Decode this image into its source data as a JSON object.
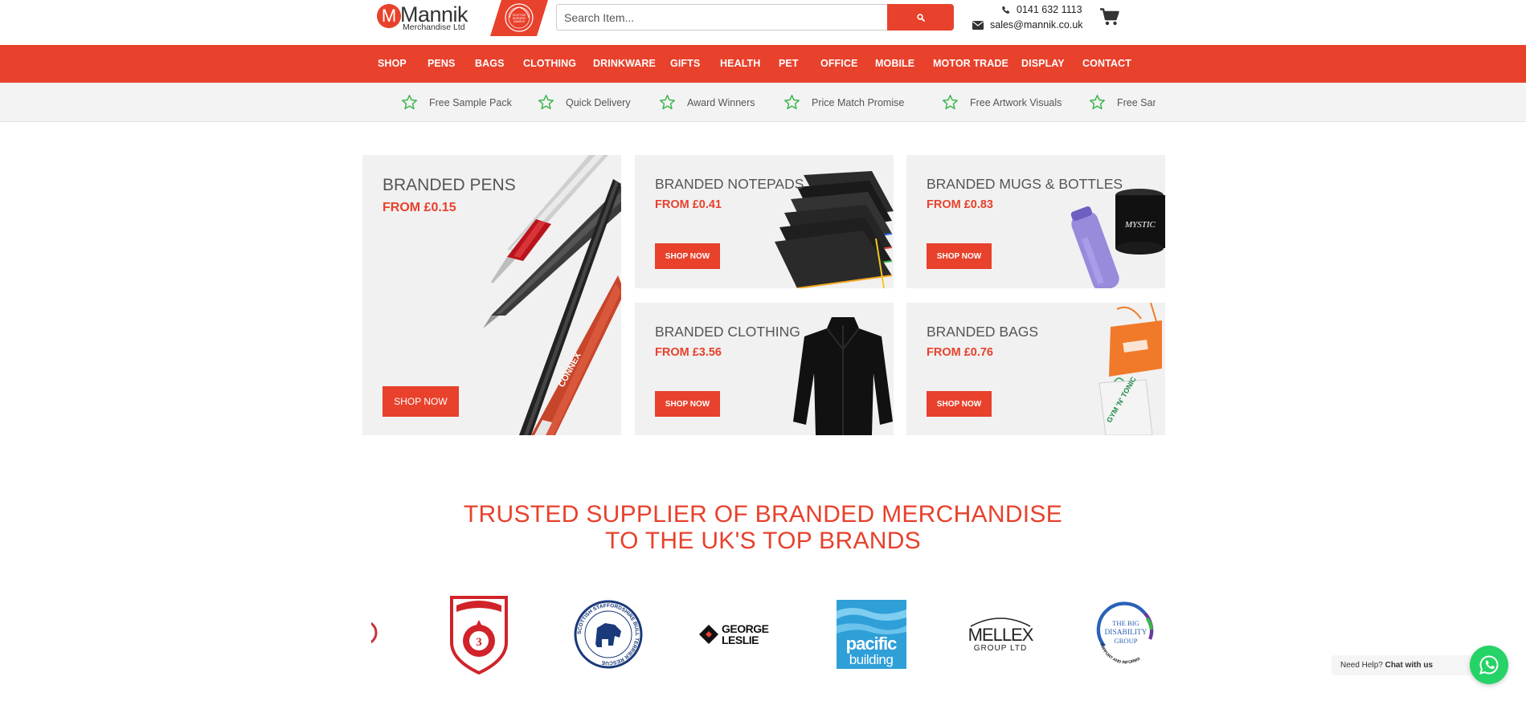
{
  "header": {
    "logo_letter": "M",
    "logo_name": "Mannik",
    "logo_sub": "Merchandise Ltd",
    "award_text": "SCOTTISH BUSINESS AWARDS",
    "search_placeholder": "Search Item...",
    "phone": "0141 632 1113",
    "email": "sales@mannik.co.uk"
  },
  "nav": {
    "items": [
      "SHOP",
      "PENS",
      "BAGS",
      "CLOTHING",
      "DRINKWARE",
      "GIFTS",
      "HEALTH",
      "PET",
      "OFFICE",
      "MOBILE",
      "MOTOR TRADE",
      "DISPLAY",
      "CONTACT"
    ]
  },
  "usp": {
    "items": [
      "Free Sample Pack",
      "Quick Delivery",
      "Award Winners",
      "Price Match Promise",
      "Free Artwork Visuals",
      "Free Sample Pack"
    ]
  },
  "tiles": {
    "pens": {
      "title": "BRANDED PENS",
      "price": "FROM £0.15",
      "button": "SHOP NOW",
      "pen_brand": "CONNEX"
    },
    "notepads": {
      "title": "BRANDED NOTEPADS",
      "price": "FROM £0.41",
      "button": "SHOP NOW"
    },
    "mugs": {
      "title": "BRANDED MUGS & BOTTLES",
      "price": "FROM £0.83",
      "button": "SHOP NOW",
      "mug_text": "MYSTIC"
    },
    "clothing": {
      "title": "BRANDED CLOTHING",
      "price": "FROM £3.56",
      "button": "SHOP NOW"
    },
    "bags": {
      "title": "BRANDED BAGS",
      "price": "FROM £0.76",
      "button": "SHOP NOW",
      "bag_text": "GYM 'N' TONIC"
    }
  },
  "trusted": {
    "line1": "TRUSTED SUPPLIER OF BRANDED MERCHANDISE",
    "line2": "TO THE UK'S TOP BRANDS"
  },
  "brands": {
    "george_leslie": "GEORGE LESLIE",
    "george_line1": "GEORGE",
    "george_line2": "LESLIE",
    "pacific_line1": "pacific",
    "pacific_line2": "building",
    "mellex_line1": "MELLEX",
    "mellex_line2": "GROUP LTD",
    "staffy_text": "SCOTTISH STAFFORDSHIRE BULL TERRIER RESCUE",
    "disability_line1": "THE BIG",
    "disability_line2": "DISABILITY",
    "disability_line3": "GROUP",
    "disability_ring": "SUPPORT AND INFORMA",
    "shield_text": "3"
  },
  "chat": {
    "prompt": "Need Help?",
    "action": "Chat with us"
  },
  "colors": {
    "accent": "#e8412c",
    "whatsapp": "#25d366",
    "usp_star": "#3ab54a"
  }
}
